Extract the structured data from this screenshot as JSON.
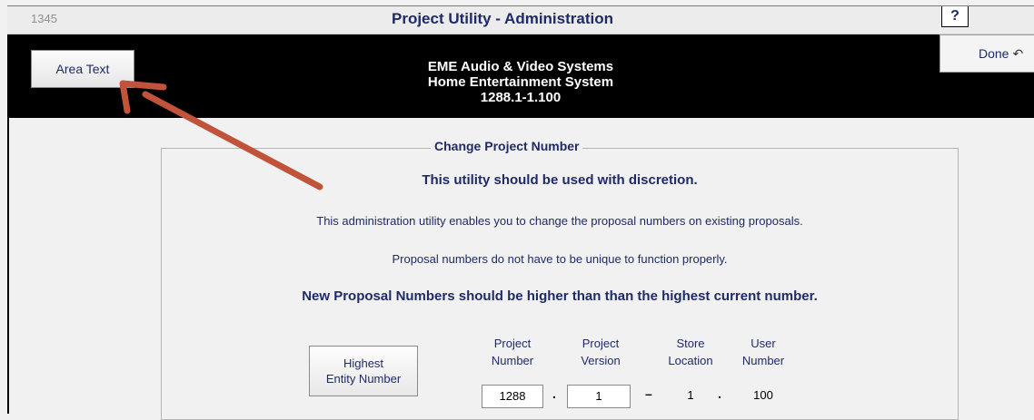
{
  "window": {
    "record_id": "1345",
    "title": "Project Utility - Administration",
    "help_label": "?"
  },
  "header": {
    "area_text_button": "Area Text",
    "company": "EME Audio & Video Systems",
    "project_name": "Home Entertainment System",
    "project_code": "1288.1-1.100",
    "done_button": "Done",
    "done_icon": "undo-arrow-icon"
  },
  "panel": {
    "legend": "Change Project Number",
    "warning": "This utility should be used with discretion.",
    "info_line_1": "This administration utility enables you to change the proposal numbers on existing proposals.",
    "info_line_2": "Proposal numbers do not have to be unique to function properly.",
    "important": "New Proposal Numbers should be higher than than the highest current number.",
    "entity_button": {
      "line1": "Highest",
      "line2": "Entity Number"
    },
    "columns": {
      "project_number": {
        "line1": "Project",
        "line2": "Number",
        "value": "1288"
      },
      "project_version": {
        "line1": "Project",
        "line2": "Version",
        "value": "1"
      },
      "store_location": {
        "line1": "Store",
        "line2": "Location",
        "value": "1"
      },
      "user_number": {
        "line1": "User",
        "line2": "Number",
        "value": "100"
      }
    },
    "separators": {
      "dot": ".",
      "dash": "–"
    }
  },
  "colors": {
    "accent_text": "#1f2a66",
    "header_bg": "#000000",
    "arrow": "#c0533a"
  }
}
